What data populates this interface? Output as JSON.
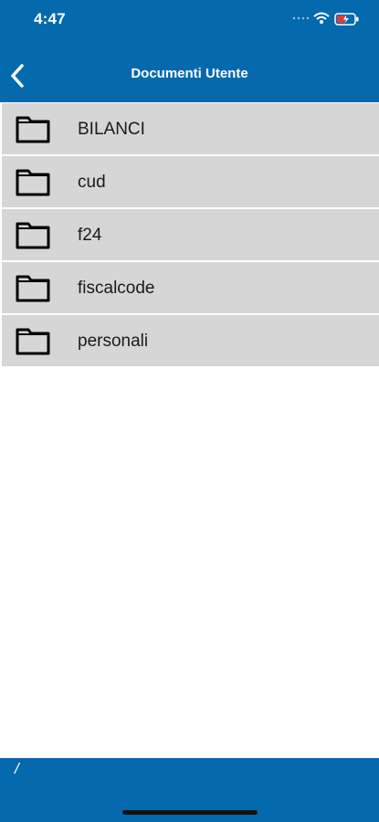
{
  "status_bar": {
    "time": "4:47"
  },
  "header": {
    "title": "Documenti Utente",
    "background": "#0569ad"
  },
  "folders": [
    {
      "name": "BILANCI"
    },
    {
      "name": "cud"
    },
    {
      "name": "f24"
    },
    {
      "name": "fiscalcode"
    },
    {
      "name": "personali"
    }
  ],
  "footer": {
    "path": "/"
  },
  "icons": {
    "back": "chevron-left-icon",
    "folder": "folder-icon",
    "wifi": "wifi-icon",
    "battery": "battery-icon",
    "signal": "cellular-signal-icon"
  }
}
